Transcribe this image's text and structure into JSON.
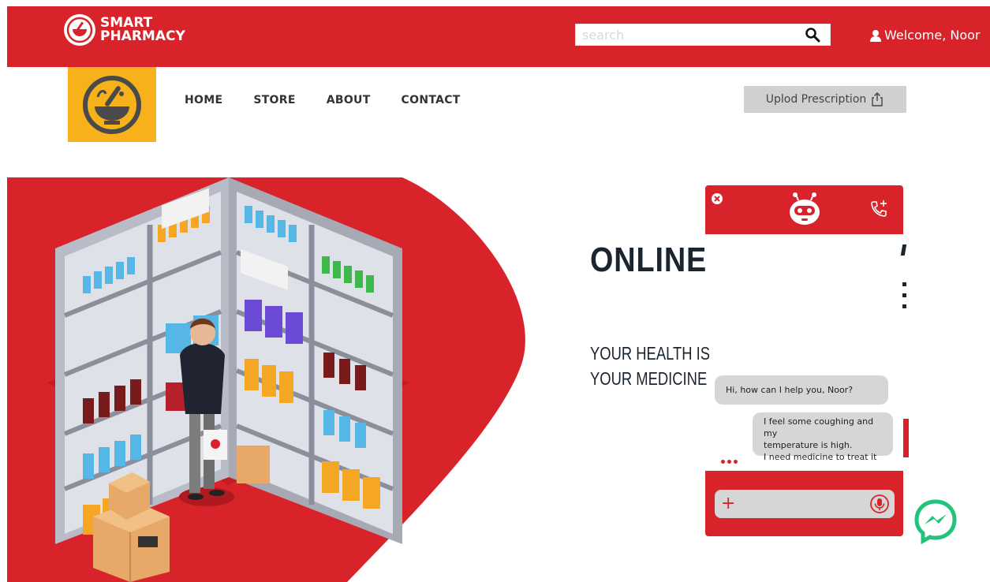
{
  "header": {
    "brand_line1": "SMART",
    "brand_line2": "PHARMACY",
    "search_placeholder": "search",
    "welcome": "Welcome, Noor"
  },
  "nav": {
    "home": "HOME",
    "store": "STORE",
    "about": "ABOUT",
    "contact": "CONTACT"
  },
  "upload_button": "Uplod Prescription",
  "hero": {
    "headline": "ONLINE",
    "sub_line1": "YOUR HEALTH IS",
    "sub_line2": "YOUR MEDICINE"
  },
  "chat": {
    "bot_message": "Hi, how can I help you, Noor?",
    "user_line1": "I feel some coughing and my",
    "user_line2": "temperature is high.",
    "user_line3": "I need medicine to treat it",
    "input_placeholder": ""
  },
  "colors": {
    "brand_red": "#d8232a",
    "logo_yellow": "#f7b21b",
    "text_dark": "#1b2530",
    "bubble_gray": "#d6d6d6",
    "messenger_green": "#22c37a"
  },
  "icons": [
    "pharmacy-logo-icon",
    "search-icon",
    "user-icon",
    "upload-icon",
    "close-icon",
    "chatbot-icon",
    "phone-add-icon",
    "plus-icon",
    "microphone-icon",
    "messenger-icon"
  ]
}
